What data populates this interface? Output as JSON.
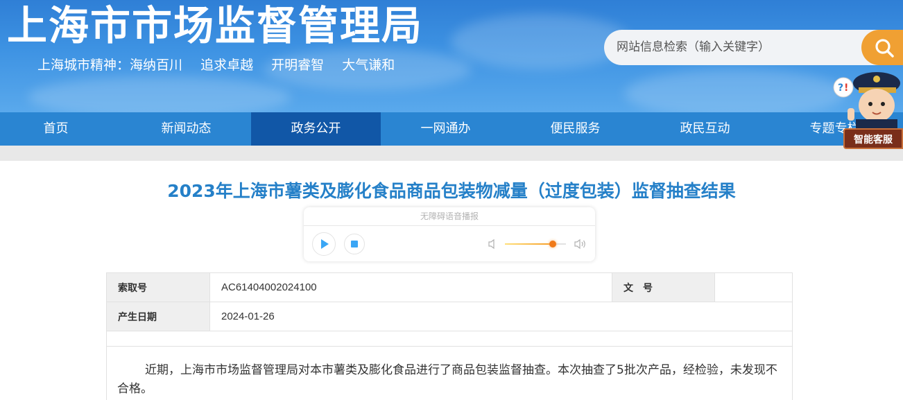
{
  "header": {
    "site_title": "上海市市场监督管理局",
    "spirit_lead": "上海城市精神：海纳百川",
    "spirit_items": [
      "追求卓越",
      "开明睿智",
      "大气谦和"
    ],
    "search_placeholder": "网站信息检索（输入关键字）",
    "search_icon": "search-icon"
  },
  "nav": {
    "items": [
      "首页",
      "新闻动态",
      "政务公开",
      "一网通办",
      "便民服务",
      "政民互动",
      "专题专栏"
    ],
    "active_index": 2
  },
  "assistant": {
    "label": "智能客服"
  },
  "article": {
    "title": "2023年上海市薯类及膨化食品商品包装物减量（过度包装）监督抽查结果",
    "player": {
      "header": "无障碍语音播报",
      "volume": 0.78
    },
    "info": {
      "index_label": "索取号",
      "index_value": "AC61404002024100",
      "doc_label": "文　号",
      "doc_value": "",
      "date_label": "产生日期",
      "date_value": "2024-01-26"
    },
    "paragraph": "近期，上海市市场监督管理局对本市薯类及膨化食品进行了商品包装监督抽查。本次抽查了5批次产品，经检验，未发现不合格。"
  },
  "colors": {
    "banner": "#3e93e3",
    "nav": "#2a85d2",
    "nav_active": "#1157a7",
    "title": "#2580c8",
    "search_button": "#f0a033"
  }
}
